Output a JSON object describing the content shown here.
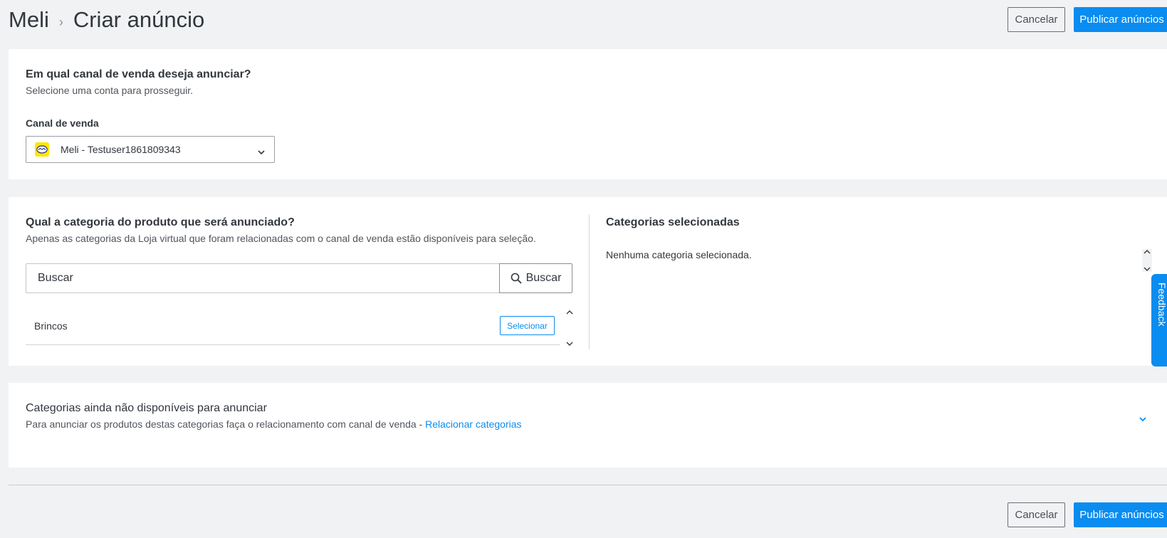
{
  "header": {
    "breadcrumb_root": "Meli",
    "breadcrumb_separator": "›",
    "breadcrumb_current": "Criar anúncio",
    "cancel_label": "Cancelar",
    "publish_label": "Publicar anúncios"
  },
  "channel_section": {
    "title": "Em qual canal de venda deseja anunciar?",
    "subtitle": "Selecione uma conta para prosseguir.",
    "field_label": "Canal de venda",
    "selected_value": "Meli - Testuser1861809343"
  },
  "category_section": {
    "title": "Qual a categoria do produto que será anunciado?",
    "subtitle": "Apenas as categorias da Loja virtual que foram relacionadas com o canal de venda estão disponíveis para seleção.",
    "search_placeholder": "Buscar",
    "search_button_label": "Buscar",
    "items": [
      {
        "name": "Brincos",
        "action_label": "Selecionar"
      }
    ],
    "selected_title": "Categorias selecionadas",
    "selected_empty_text": "Nenhuma categoria selecionada."
  },
  "unavailable_section": {
    "title": "Categorias ainda não disponíveis para anunciar",
    "description": "Para anunciar os produtos destas categorias faça o relacionamento com canal de venda -",
    "link_label": "Relacionar categorias"
  },
  "footer": {
    "cancel_label": "Cancelar",
    "publish_label": "Publicar anúncios"
  },
  "feedback_tab": {
    "label": "Feedback"
  },
  "colors": {
    "primary": "#0a8cf0",
    "background": "#f1f2f4",
    "card": "#ffffff",
    "brand_yellow": "#ffe600"
  },
  "icons": {
    "channel_logo": "mercadolivre-handshake-icon",
    "select_arrow": "chevron-down-icon",
    "search": "search-icon",
    "expand": "chevron-down-icon",
    "feedback": "feedback-icon"
  }
}
